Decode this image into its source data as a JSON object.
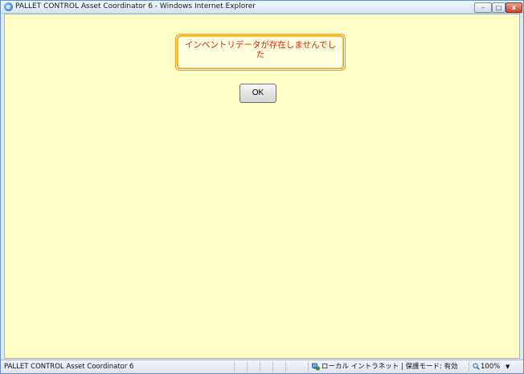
{
  "window": {
    "title": "PALLET CONTROL Asset Coordinator 6 - Windows Internet Explorer",
    "controls": {
      "minimize": "–",
      "maximize": "□",
      "close": "x"
    }
  },
  "dialog": {
    "message": "インベントリデータが存在しませんでした",
    "ok_label": "OK"
  },
  "statusbar": {
    "text": "PALLET CONTROL Asset Coordinator 6",
    "zone": "ローカル イントラネット | 保護モード: 有効",
    "zoom": "100%"
  },
  "colors": {
    "page_background": "#ffffc6",
    "message_text": "#d4240f",
    "message_border": "#ee9a1f"
  },
  "icons": [
    "ie-icon",
    "minimize-icon",
    "maximize-icon",
    "close-icon",
    "intranet-zone-icon",
    "zoom-icon",
    "dropdown-arrow-icon"
  ]
}
